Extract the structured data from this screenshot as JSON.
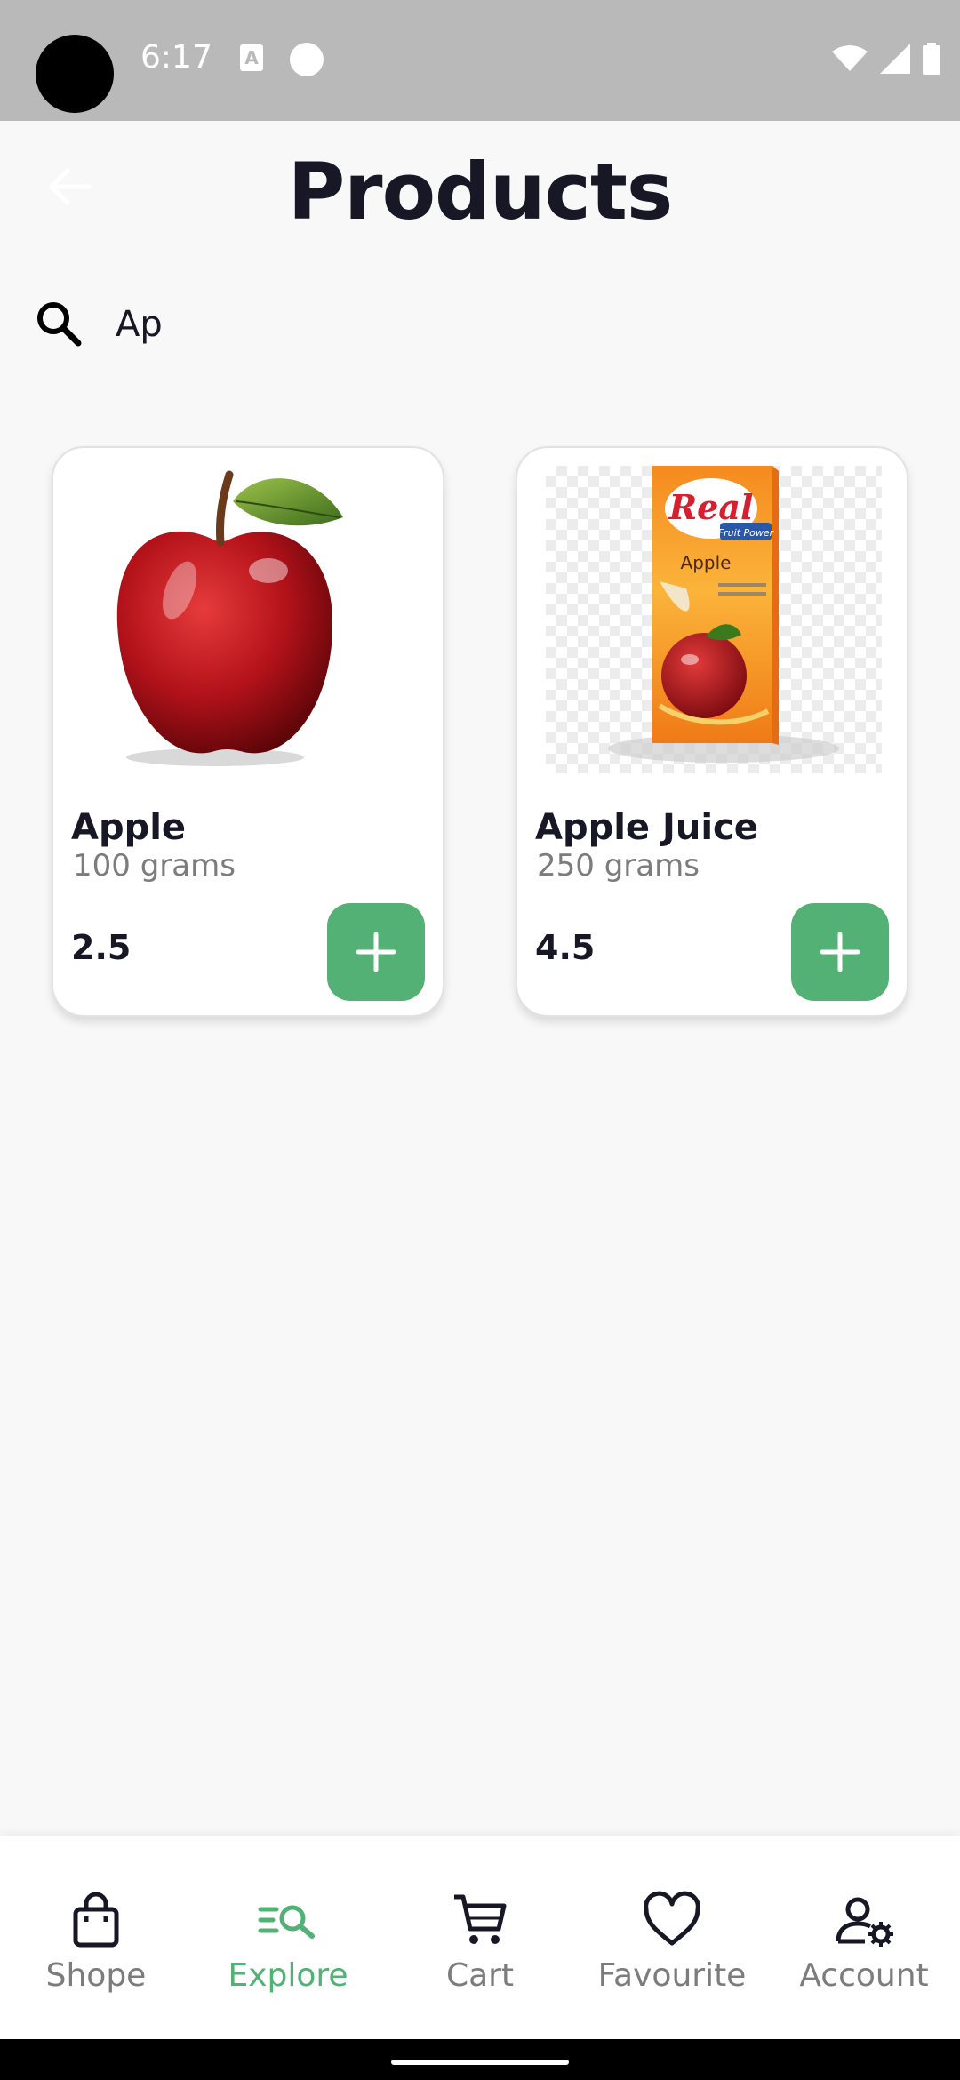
{
  "status_bar": {
    "time": "6:17",
    "icons": [
      "a-notification-icon",
      "p-notification-icon",
      "wifi-icon",
      "signal-icon",
      "battery-icon"
    ]
  },
  "header": {
    "title": "Products",
    "back_icon": "arrow-left-icon"
  },
  "search": {
    "value": "Ap",
    "icon": "search-icon"
  },
  "products": [
    {
      "name": "Apple",
      "weight": "100 grams",
      "price": "2.5",
      "image": "red-apple"
    },
    {
      "name": "Apple Juice",
      "weight": "250 grams",
      "price": "4.5",
      "image": "real-apple-juice-carton"
    }
  ],
  "juice_pack": {
    "brand": "Real",
    "sub": "Fruit Power",
    "flavour": "Apple"
  },
  "bottom_nav": {
    "items": [
      {
        "label": "Shope",
        "icon": "shopping-bag-icon",
        "active": false
      },
      {
        "label": "Explore",
        "icon": "explore-icon",
        "active": true
      },
      {
        "label": "Cart",
        "icon": "cart-icon",
        "active": false
      },
      {
        "label": "Favourite",
        "icon": "heart-icon",
        "active": false
      },
      {
        "label": "Account",
        "icon": "account-settings-icon",
        "active": false
      }
    ]
  },
  "colors": {
    "accent": "#53b175",
    "text_primary": "#181725",
    "text_secondary": "#7c7c7c",
    "status_bar": "#b9b9b9"
  }
}
